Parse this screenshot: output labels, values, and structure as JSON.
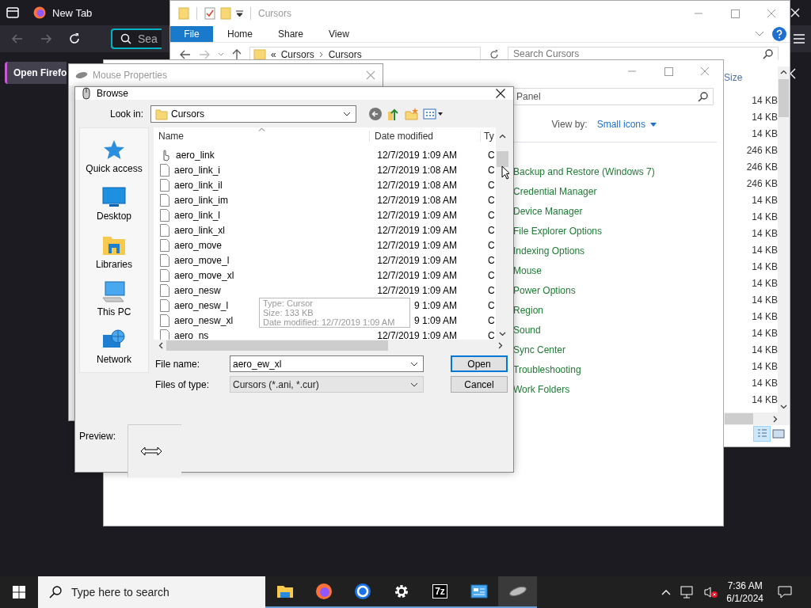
{
  "browser": {
    "tab_title": "New Tab",
    "search_placeholder": "Sea",
    "banner_button": "Open Firefo"
  },
  "explorer": {
    "title": "Cursors",
    "ribbon_tabs": [
      {
        "label": "File",
        "selected": true
      },
      {
        "label": "Home",
        "selected": false
      },
      {
        "label": "Share",
        "selected": false
      },
      {
        "label": "View",
        "selected": false
      }
    ],
    "address": [
      "«",
      "Cursors",
      "Cursors"
    ],
    "search_placeholder": "Search Cursors",
    "size_header": "Size",
    "sizes": [
      "14 KB",
      "14 KB",
      "14 KB",
      "246 KB",
      "246 KB",
      "246 KB",
      "14 KB",
      "14 KB",
      "14 KB",
      "14 KB",
      "14 KB",
      "14 KB",
      "14 KB",
      "14 KB",
      "14 KB",
      "14 KB",
      "14 KB",
      "14 KB",
      "14 KB"
    ]
  },
  "control_panel": {
    "search_value": "Panel",
    "view_by_label": "View by:",
    "view_by_value": "Small icons",
    "items": [
      "Backup and Restore (Windows 7)",
      "Credential Manager",
      "Device Manager",
      "File Explorer Options",
      "Indexing Options",
      "Mouse",
      "Power Options",
      "Region",
      "Sound",
      "Sync Center",
      "Troubleshooting",
      "Work Folders"
    ]
  },
  "mouse_properties": {
    "title": "Mouse Properties"
  },
  "browse": {
    "title": "Browse",
    "look_in_label": "Look in:",
    "look_in_value": "Cursors",
    "places": [
      {
        "label": "Quick access",
        "kind": "star"
      },
      {
        "label": "Desktop",
        "kind": "desktop"
      },
      {
        "label": "Libraries",
        "kind": "libraries"
      },
      {
        "label": "This PC",
        "kind": "pc"
      },
      {
        "label": "Network",
        "kind": "network"
      }
    ],
    "columns": [
      "Name",
      "Date modified",
      "Ty"
    ],
    "files": [
      {
        "name": "aero_link",
        "date": "12/7/2019 1:09 AM",
        "type": "C",
        "kind": "hand"
      },
      {
        "name": "aero_link_i",
        "date": "12/7/2019 1:08 AM",
        "type": "C",
        "kind": "file"
      },
      {
        "name": "aero_link_il",
        "date": "12/7/2019 1:08 AM",
        "type": "C",
        "kind": "file"
      },
      {
        "name": "aero_link_im",
        "date": "12/7/2019 1:08 AM",
        "type": "C",
        "kind": "file"
      },
      {
        "name": "aero_link_l",
        "date": "12/7/2019 1:09 AM",
        "type": "C",
        "kind": "file"
      },
      {
        "name": "aero_link_xl",
        "date": "12/7/2019 1:09 AM",
        "type": "C",
        "kind": "file"
      },
      {
        "name": "aero_move",
        "date": "12/7/2019 1:09 AM",
        "type": "C",
        "kind": "file"
      },
      {
        "name": "aero_move_l",
        "date": "12/7/2019 1:09 AM",
        "type": "C",
        "kind": "file"
      },
      {
        "name": "aero_move_xl",
        "date": "12/7/2019 1:09 AM",
        "type": "C",
        "kind": "file"
      },
      {
        "name": "aero_nesw",
        "date": "12/7/2019 1:09 AM",
        "type": "C",
        "kind": "file"
      },
      {
        "name": "aero_nesw_l",
        "date": "9 1:09 AM",
        "type": "C",
        "kind": "file"
      },
      {
        "name": "aero_nesw_xl",
        "date": "9 1:09 AM",
        "type": "C",
        "kind": "file"
      },
      {
        "name": "aero_ns",
        "date": "12/7/2019 1:09 AM",
        "type": "C",
        "kind": "file"
      }
    ],
    "tooltip": [
      "Type: Cursor",
      "Size: 133 KB",
      "Date modified: 12/7/2019 1:09 AM"
    ],
    "file_name_label": "File name:",
    "file_name_value": "aero_ew_xl",
    "file_type_label": "Files of type:",
    "file_type_value": "Cursors (*.ani, *.cur)",
    "buttons": [
      {
        "label": "Open",
        "default": true
      },
      {
        "label": "Cancel",
        "default": false
      }
    ],
    "preview_label": "Preview:"
  },
  "taskbar": {
    "search_placeholder": "Type here to search",
    "apps": [
      {
        "kind": "folder",
        "selected": false
      },
      {
        "kind": "browser",
        "selected": false
      },
      {
        "kind": "circle",
        "selected": false
      },
      {
        "kind": "gear",
        "selected": false
      },
      {
        "kind": "archive",
        "label": "7z",
        "selected": false
      },
      {
        "kind": "panel",
        "selected": false
      },
      {
        "kind": "mouse",
        "selected": true
      }
    ],
    "time": "7:36 AM",
    "date": "6/1/2024"
  }
}
